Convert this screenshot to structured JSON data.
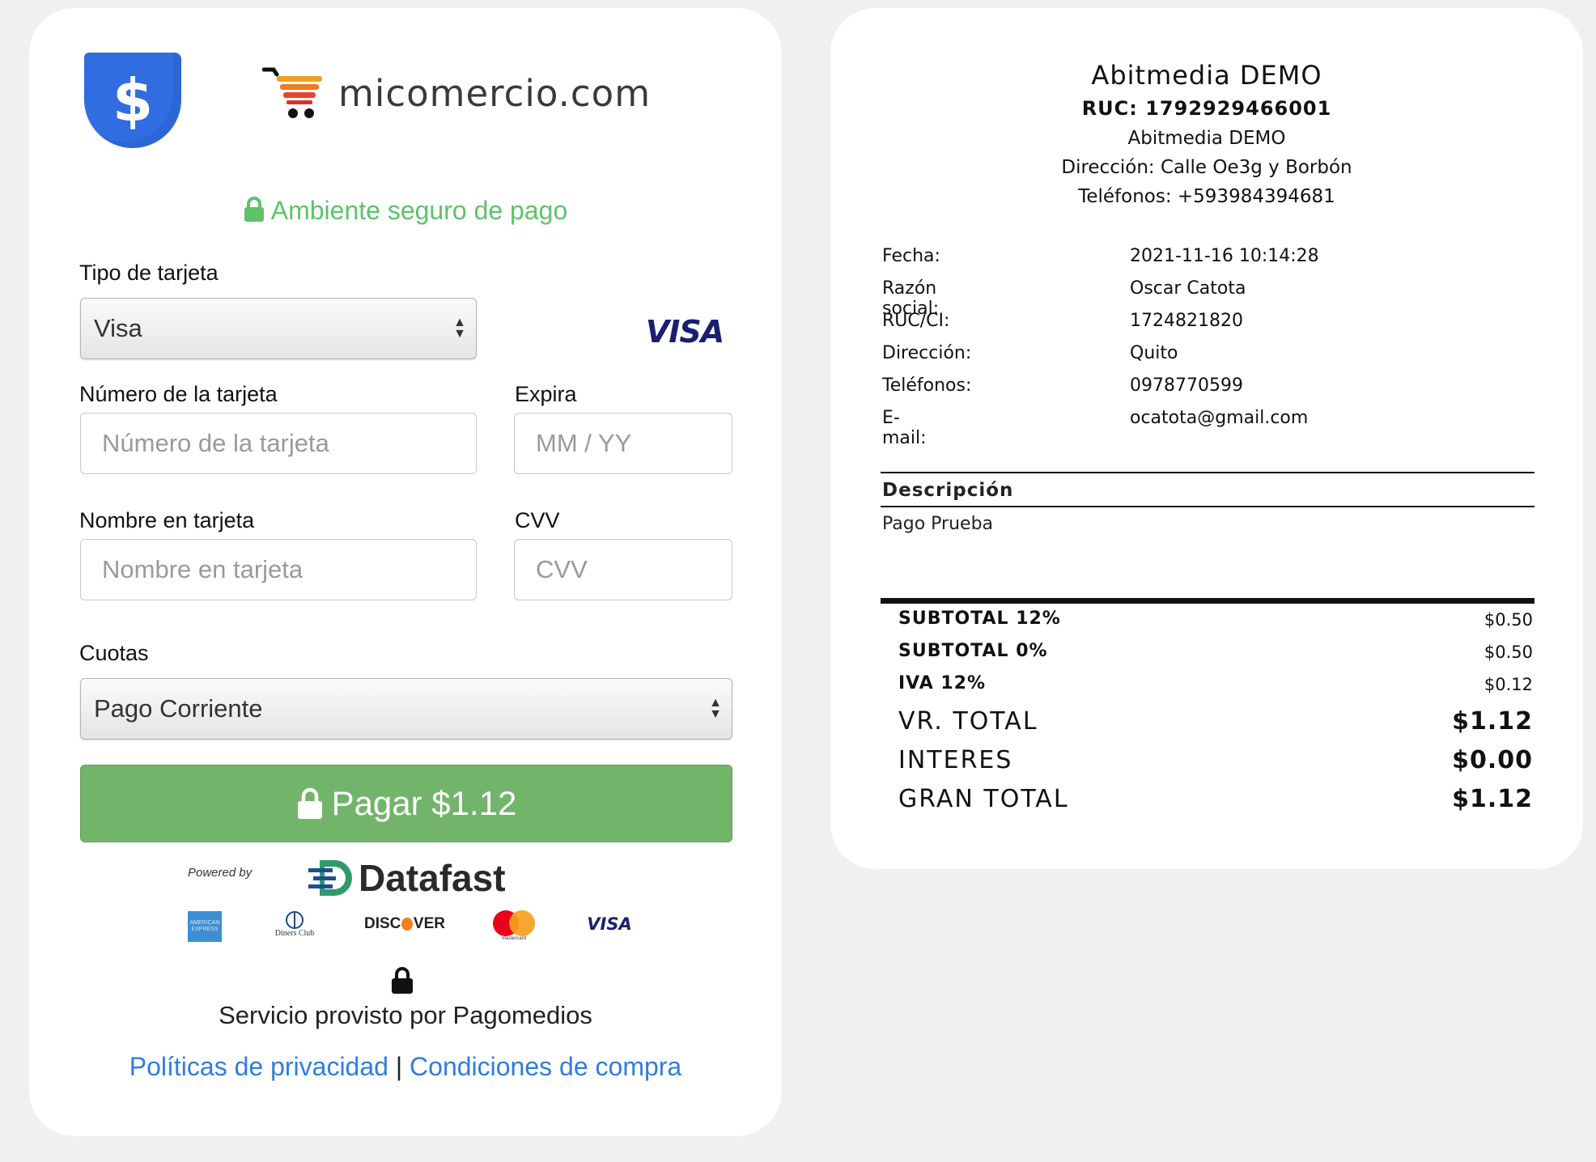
{
  "merchant": {
    "logo_text": "micomercio.com",
    "shield_symbol": "$"
  },
  "secure": {
    "icon": "lock-icon",
    "text": "Ambiente seguro de pago"
  },
  "form": {
    "card_type_label": "Tipo de tarjeta",
    "card_type_value": "Visa",
    "card_brand_badge": "VISA",
    "card_number_label": "Número de la tarjeta",
    "card_number_placeholder": "Número de la tarjeta",
    "expiry_label": "Expira",
    "expiry_placeholder": "MM / YY",
    "card_name_label": "Nombre en tarjeta",
    "card_name_placeholder": "Nombre en tarjeta",
    "cvv_label": "CVV",
    "cvv_placeholder": "CVV",
    "installments_label": "Cuotas",
    "installments_value": "Pago Corriente",
    "pay_button": "Pagar $1.12"
  },
  "footer": {
    "powered_by": "Powered by",
    "processor": "Datafast",
    "brands": [
      "amex-logo",
      "diners-club-logo",
      "discover-logo",
      "mastercard-logo",
      "visa-logo"
    ],
    "discover_text_a": "DISC",
    "discover_text_b": "VER",
    "diners_text": "Diners Club",
    "mastercard_text": "mastercard",
    "visa_text": "VISA",
    "service_text": "Servicio provisto por Pagomedios",
    "privacy_link": "Políticas de privacidad",
    "separator": "|",
    "terms_link": "Condiciones de compra"
  },
  "receipt": {
    "company": "Abitmedia DEMO",
    "ruc": "RUC: 1792929466001",
    "name": "Abitmedia DEMO",
    "address": "Dirección: Calle Oe3g y Borbón",
    "phones": "Teléfonos: +593984394681",
    "info": [
      {
        "label": "Fecha:",
        "value": "2021-11-16 10:14:28"
      },
      {
        "label": "Razón social:",
        "value": "Oscar Catota"
      },
      {
        "label": "RUC/CI:",
        "value": "1724821820"
      },
      {
        "label": "Dirección:",
        "value": "Quito"
      },
      {
        "label": "Teléfonos:",
        "value": "0978770599"
      },
      {
        "label": "E-mail:",
        "value": "ocatota@gmail.com"
      }
    ],
    "description_header": "Descripción",
    "description_item": "Pago Prueba",
    "totals": [
      {
        "label": "SUBTOTAL 12%",
        "value": "$0.50"
      },
      {
        "label": "SUBTOTAL 0%",
        "value": "$0.50"
      },
      {
        "label": "IVA 12%",
        "value": "$0.12"
      },
      {
        "label": "VR. TOTAL",
        "value": "$1.12"
      },
      {
        "label": "INTERES",
        "value": "$0.00"
      },
      {
        "label": "GRAN TOTAL",
        "value": "$1.12"
      }
    ]
  },
  "colors": {
    "accent_green": "#73b46b",
    "secure_green": "#5fc26a",
    "link_blue": "#2f7de1",
    "shield_blue": "#2f6de1"
  }
}
